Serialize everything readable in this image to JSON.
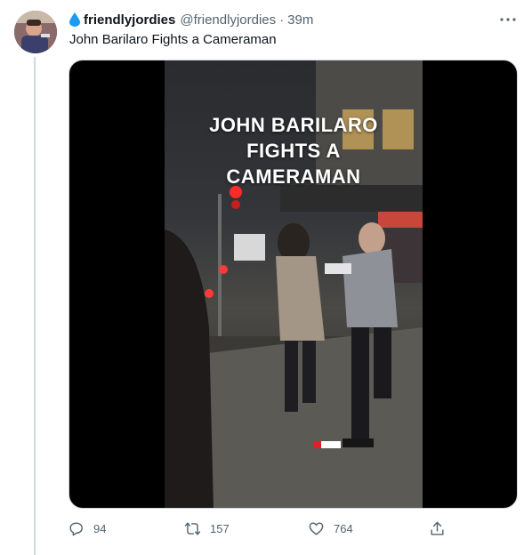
{
  "tweet": {
    "display_name": "friendlyjordies",
    "handle": "@friendlyjordies",
    "separator": "·",
    "time": "39m",
    "text": "John Barilaro Fights a Cameraman"
  },
  "media": {
    "caption_lines": [
      "JOHN BARILARO",
      "FIGHTS A",
      "CAMERAMAN"
    ]
  },
  "actions": {
    "replies": "94",
    "retweets": "157",
    "likes": "764"
  },
  "colors": {
    "secondary_text": "#536471",
    "verified_drop": "#1d9bf0",
    "thread_line": "#cfd9de"
  }
}
